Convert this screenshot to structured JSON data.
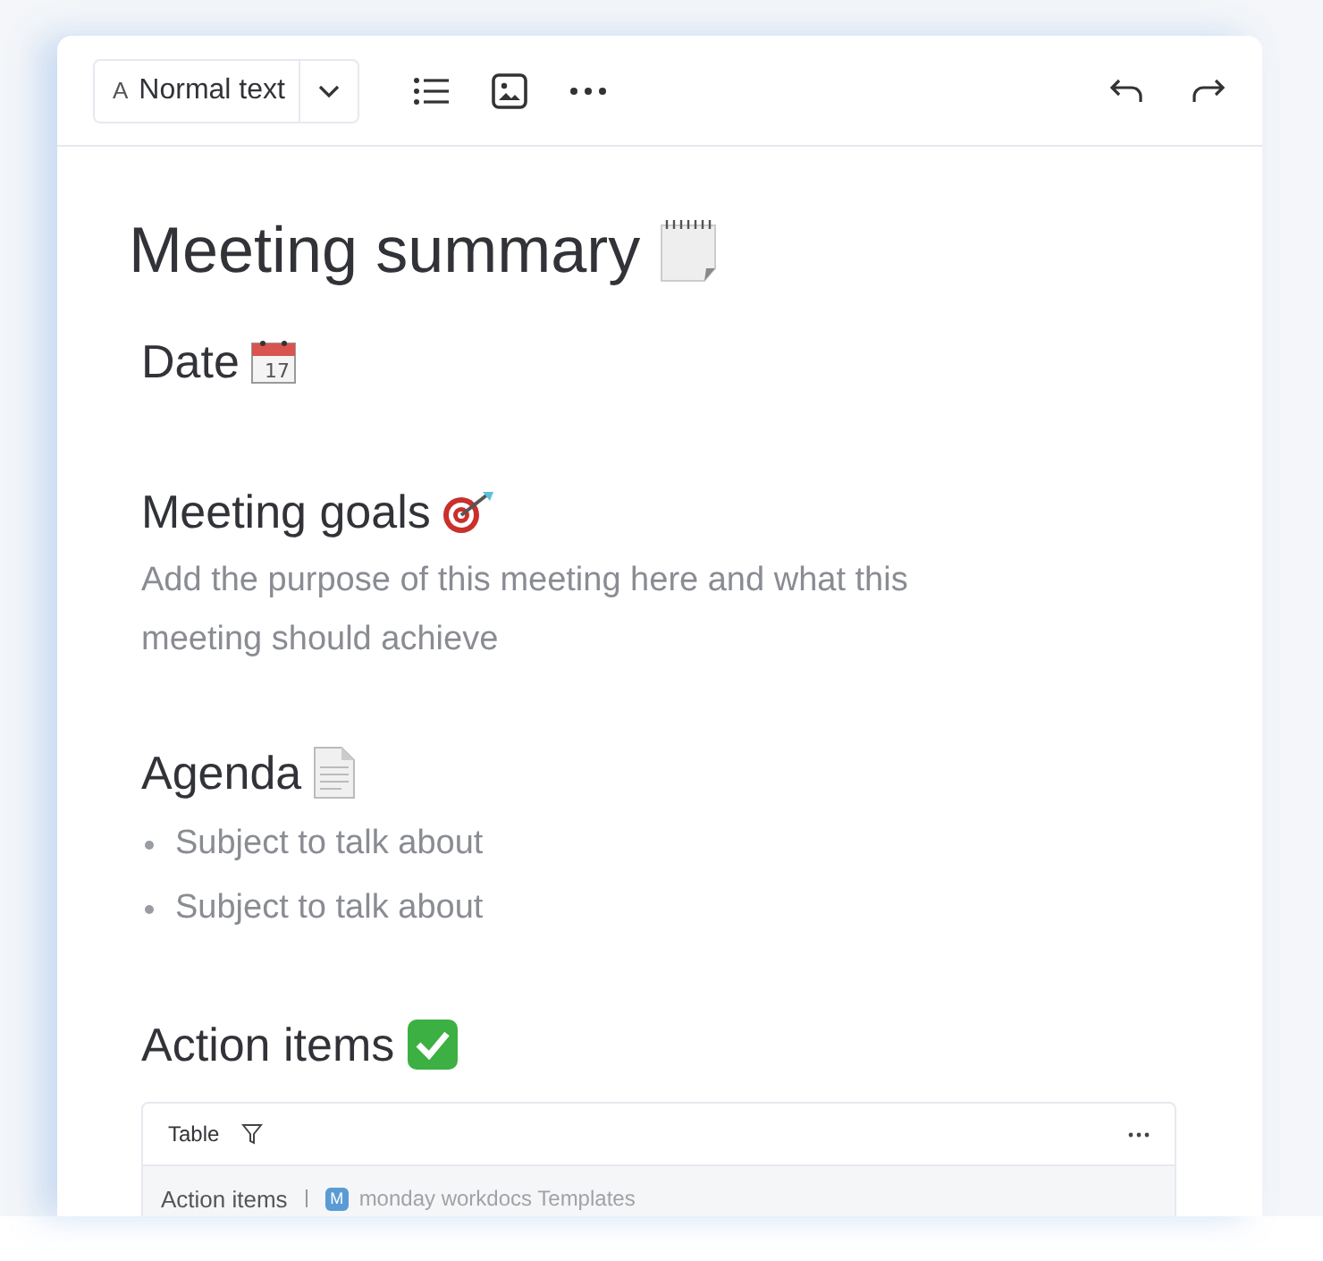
{
  "toolbar": {
    "style_glyph": "A",
    "style_label": "Normal text"
  },
  "title": "Meeting summary",
  "sections": [
    {
      "heading": "Date",
      "calendar_day": "17"
    },
    {
      "heading": "Meeting goals",
      "paragraph": "Add the purpose of this meeting here and what this meeting should achieve"
    },
    {
      "heading": "Agenda",
      "bullets": [
        "Subject to talk about",
        "Subject to talk about"
      ]
    },
    {
      "heading": "Action items"
    }
  ],
  "table": {
    "view_label": "Table",
    "board_name": "Action items",
    "workspace_badge": "M",
    "workspace_name": "monday workdocs Templates"
  }
}
